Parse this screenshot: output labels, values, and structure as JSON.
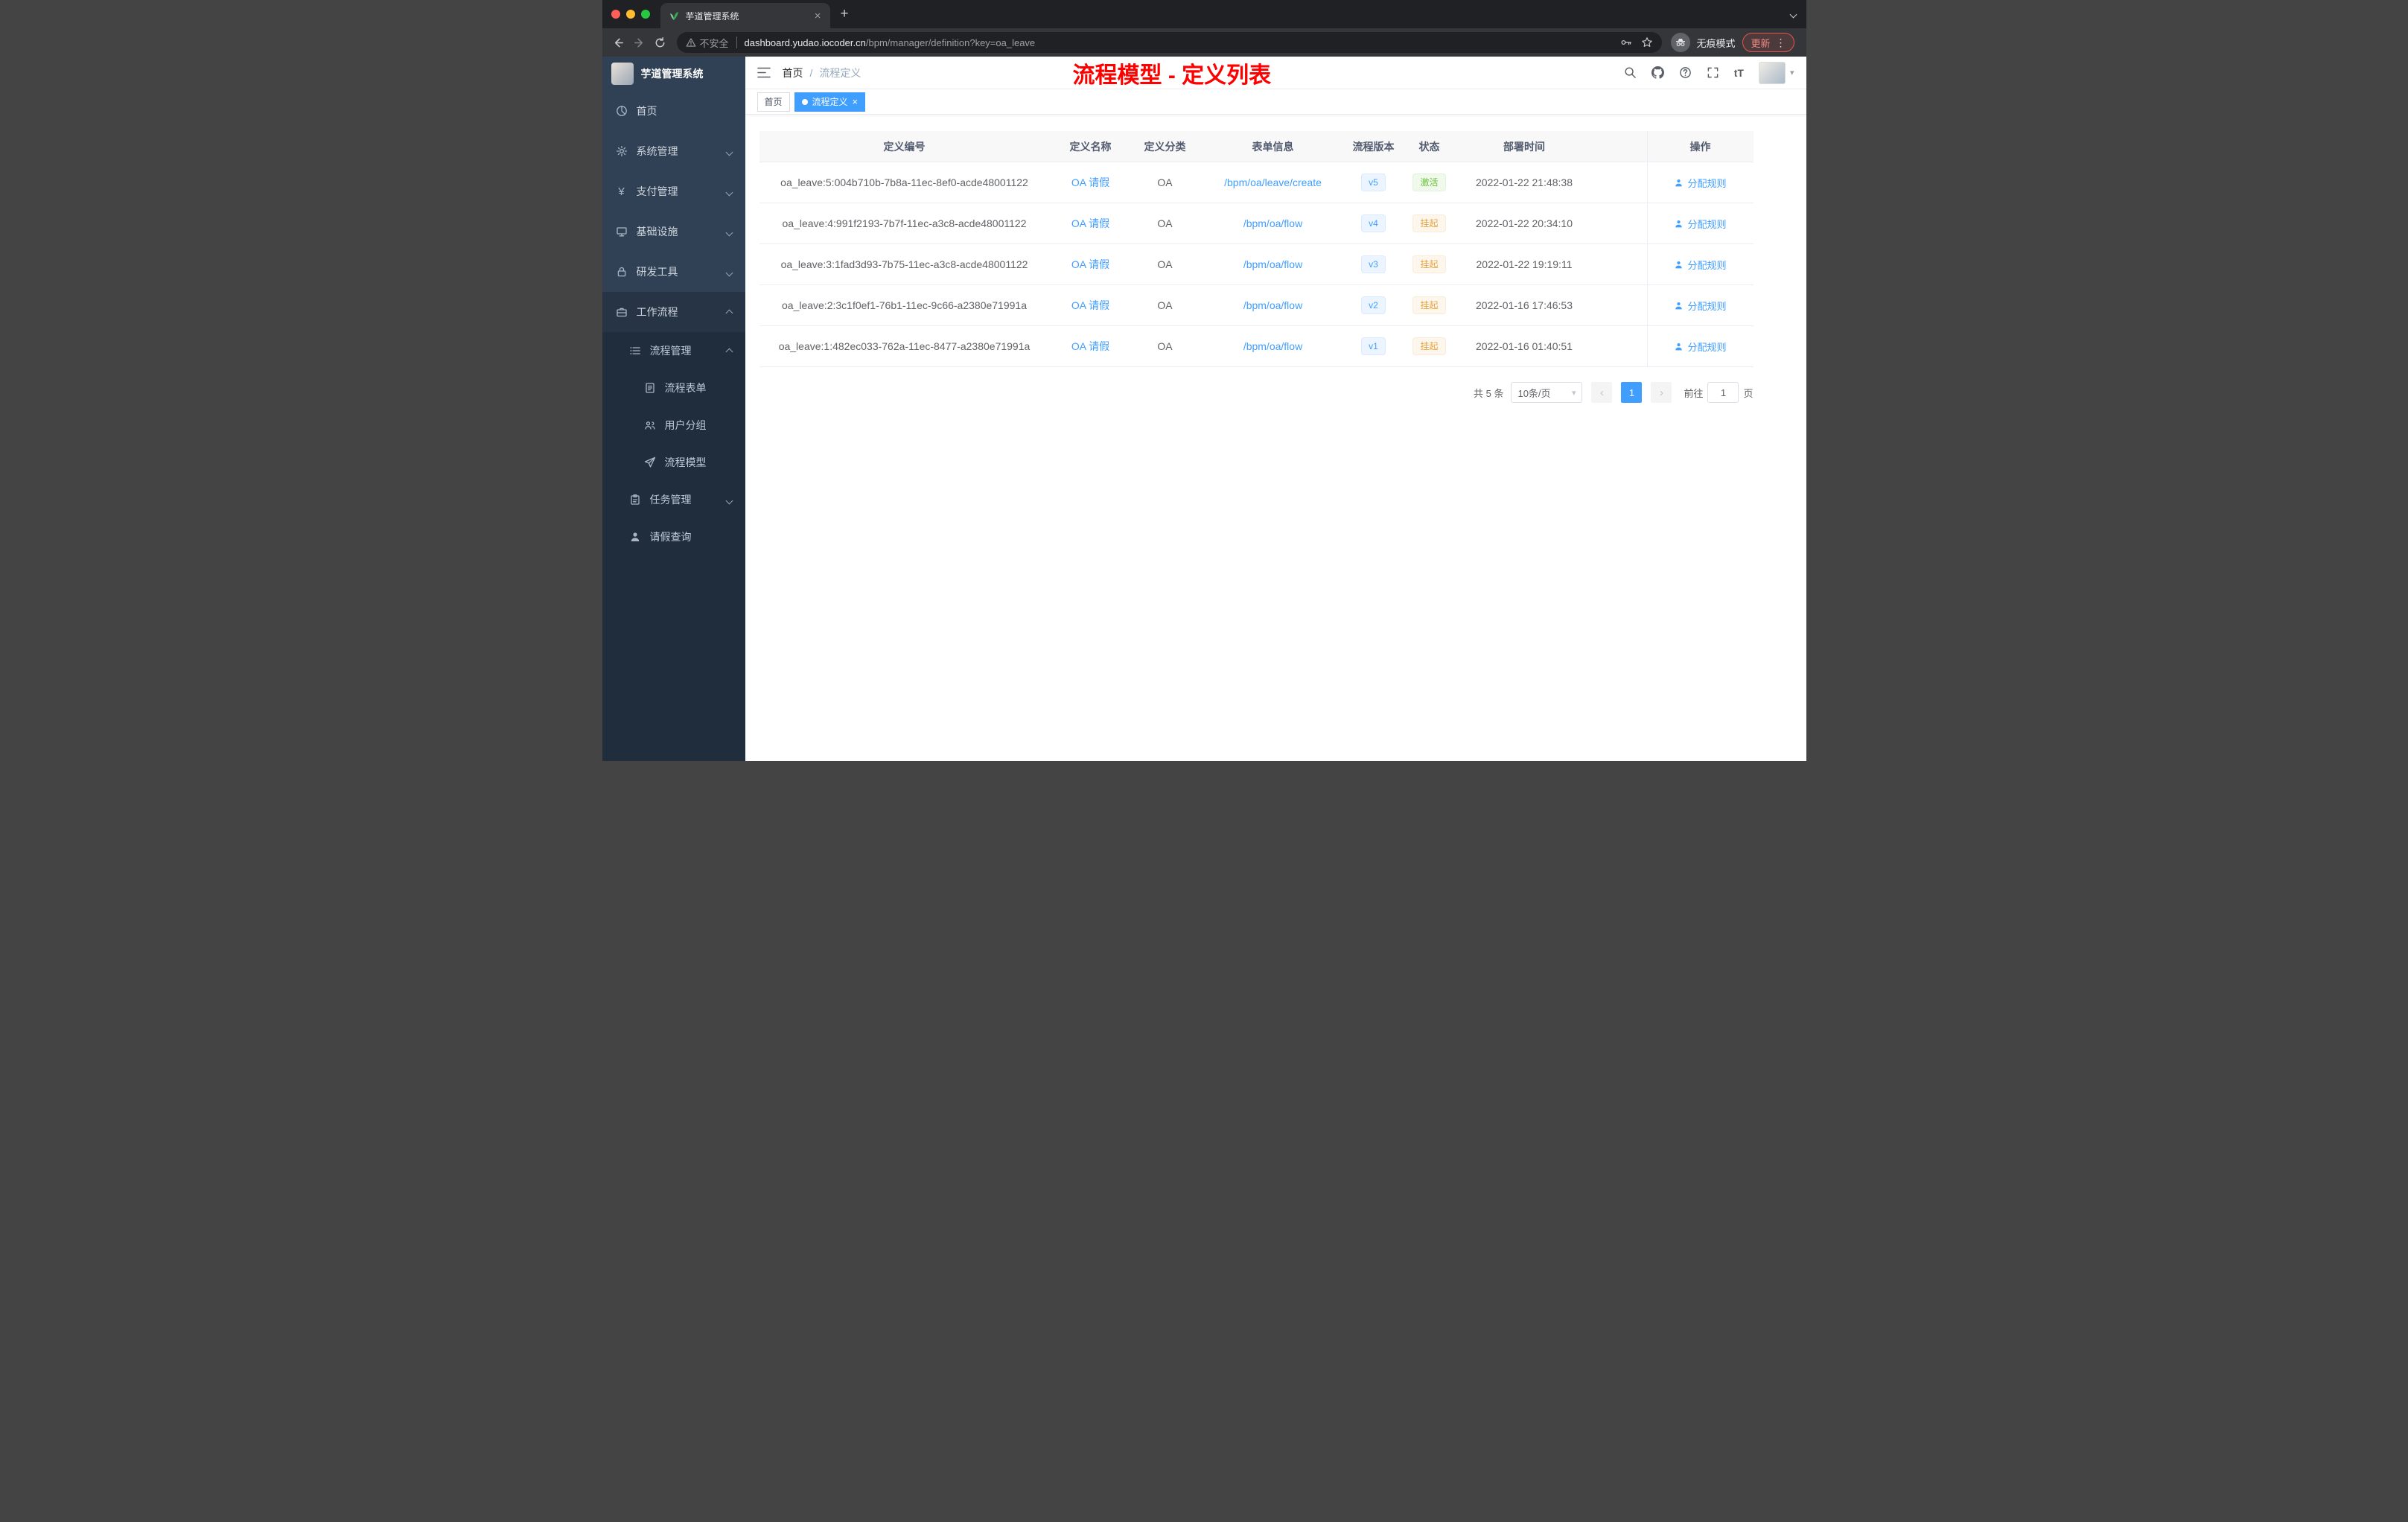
{
  "colors": {
    "accent": "#409eff",
    "success": "#67c23a",
    "warning": "#e6a23c",
    "overlay_red": "#fe0000",
    "sidebar_bg": "#304156",
    "sidebar_sub_bg": "#1f2d3d"
  },
  "icons": {
    "close": "×",
    "plus": "+",
    "more_dots": "⋮",
    "text_size": "tT",
    "caret_down": "▾",
    "prev": "‹",
    "next": "›"
  },
  "browser": {
    "tab": {
      "title": "芋道管理系统"
    },
    "toolbar": {
      "security_label": "不安全",
      "url_host": "dashboard.yudao.iocoder.cn",
      "url_path": "/bpm/manager/definition?key=oa_leave",
      "incognito_label": "无痕模式",
      "update_label": "更新"
    }
  },
  "sidebar": {
    "logo_title": "芋道管理系统",
    "items": [
      {
        "label": "首页"
      },
      {
        "label": "系统管理"
      },
      {
        "label": "支付管理"
      },
      {
        "label": "基础设施"
      },
      {
        "label": "研发工具"
      },
      {
        "label": "工作流程"
      },
      {
        "label": "流程管理"
      },
      {
        "label": "流程表单"
      },
      {
        "label": "用户分组"
      },
      {
        "label": "流程模型"
      },
      {
        "label": "任务管理"
      },
      {
        "label": "请假查询"
      }
    ]
  },
  "header": {
    "breadcrumb_home": "首页",
    "breadcrumb_sep": "/",
    "breadcrumb_current": "流程定义",
    "overlay_title": "流程模型 - 定义列表"
  },
  "tags": [
    {
      "label": "首页"
    },
    {
      "label": "流程定义"
    }
  ],
  "table": {
    "columns": [
      "定义编号",
      "定义名称",
      "定义分类",
      "表单信息",
      "流程版本",
      "状态",
      "部署时间",
      "操作"
    ],
    "rows": [
      {
        "id": "oa_leave:5:004b710b-7b8a-11ec-8ef0-acde48001122",
        "name": "OA 请假",
        "category": "OA",
        "form": "/bpm/oa/leave/create",
        "version": "v5",
        "status": "激活",
        "status_type": "success",
        "time": "2022-01-22 21:48:38",
        "action": "分配规则"
      },
      {
        "id": "oa_leave:4:991f2193-7b7f-11ec-a3c8-acde48001122",
        "name": "OA 请假",
        "category": "OA",
        "form": "/bpm/oa/flow",
        "version": "v4",
        "status": "挂起",
        "status_type": "warning",
        "time": "2022-01-22 20:34:10",
        "action": "分配规则"
      },
      {
        "id": "oa_leave:3:1fad3d93-7b75-11ec-a3c8-acde48001122",
        "name": "OA 请假",
        "category": "OA",
        "form": "/bpm/oa/flow",
        "version": "v3",
        "status": "挂起",
        "status_type": "warning",
        "time": "2022-01-22 19:19:11",
        "action": "分配规则"
      },
      {
        "id": "oa_leave:2:3c1f0ef1-76b1-11ec-9c66-a2380e71991a",
        "name": "OA 请假",
        "category": "OA",
        "form": "/bpm/oa/flow",
        "version": "v2",
        "status": "挂起",
        "status_type": "warning",
        "time": "2022-01-16 17:46:53",
        "action": "分配规则"
      },
      {
        "id": "oa_leave:1:482ec033-762a-11ec-8477-a2380e71991a",
        "name": "OA 请假",
        "category": "OA",
        "form": "/bpm/oa/flow",
        "version": "v1",
        "status": "挂起",
        "status_type": "warning",
        "time": "2022-01-16 01:40:51",
        "action": "分配规则"
      }
    ]
  },
  "pagination": {
    "total": "共 5 条",
    "page_size": "10条/页",
    "current_page": "1",
    "goto_label": "前往",
    "goto_value": "1",
    "unit": "页"
  }
}
